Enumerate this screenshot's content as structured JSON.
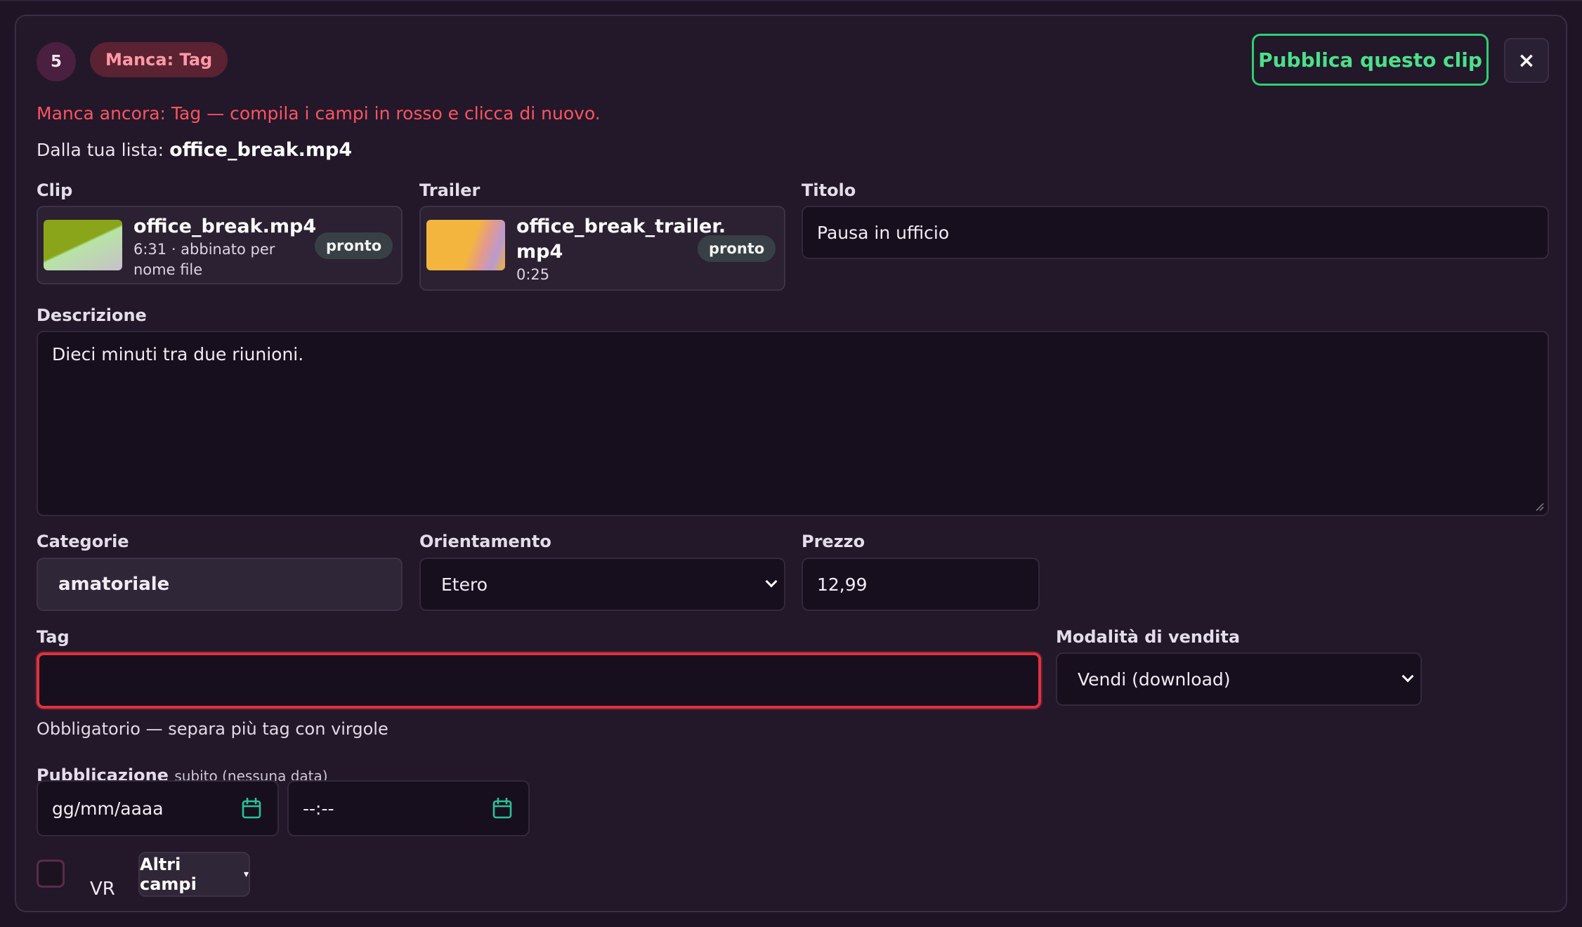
{
  "header": {
    "step_number": "5",
    "missing_badge": "Manca: Tag",
    "publish_label": "Pubblica questo clip",
    "close_label": "×"
  },
  "messages": {
    "error": "Manca ancora: Tag — compila i campi in rosso e clicca di nuovo.",
    "from_list_prefix": "Dalla tua lista:",
    "from_list_file": "office_break.mp4"
  },
  "clip": {
    "label": "Clip",
    "file_name": "office_break.mp4",
    "meta_line1": "6:31 · abbinato per",
    "meta_line2": "nome file",
    "status": "pronto"
  },
  "trailer": {
    "label": "Trailer",
    "file_name_line1": "office_break_trailer.",
    "file_name_line2": "mp4",
    "meta": "0:25",
    "status": "pronto"
  },
  "title_field": {
    "label": "Titolo",
    "value": "Pausa in ufficio"
  },
  "description_field": {
    "label": "Descrizione",
    "value": "Dieci minuti tra due riunioni."
  },
  "categories_field": {
    "label": "Categorie",
    "value": "amatoriale"
  },
  "orientation_field": {
    "label": "Orientamento",
    "value": "Etero"
  },
  "price_field": {
    "label": "Prezzo",
    "value": "12,99"
  },
  "tag_field": {
    "label": "Tag",
    "value": "",
    "hint": "Obbligatorio — separa più tag con virgole",
    "error_color": "#e0323f"
  },
  "sale_mode_field": {
    "label": "Modalità di vendita",
    "value": "Vendi (download)"
  },
  "publication": {
    "label": "Pubblicazione",
    "sublabel": "subito (nessuna data)",
    "date_placeholder": "gg/mm/aaaa",
    "time_placeholder": "--:--"
  },
  "footer": {
    "vr_label": "VR",
    "more_fields_label": "Altri campi",
    "more_fields_caret": "▾"
  },
  "colors": {
    "accent_green": "#2fcf73",
    "error_red": "#ff5362",
    "background": "#1e1426"
  }
}
